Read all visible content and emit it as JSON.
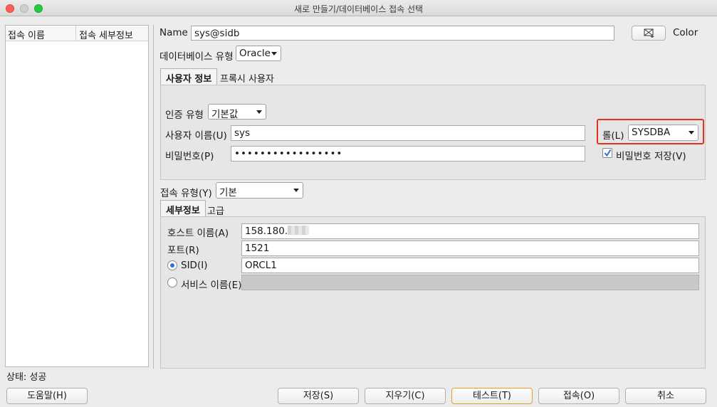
{
  "window": {
    "title": "새로 만들기/데이터베이스 접속 선택"
  },
  "connection_list": {
    "headers": [
      "접속 이름",
      "접속 세부정보"
    ]
  },
  "name": {
    "label": "Name",
    "value": "sys@sidb"
  },
  "color_button": {
    "label": "Color"
  },
  "db_type": {
    "label": "데이터베이스 유형",
    "value": "Oracle"
  },
  "tabs_top": [
    {
      "label": "사용자 정보",
      "active": true
    },
    {
      "label": "프록시 사용자",
      "active": false
    }
  ],
  "auth": {
    "label": "인증 유형",
    "value": "기본값"
  },
  "username": {
    "label": "사용자 이름(U)",
    "value": "sys"
  },
  "password": {
    "label": "비밀번호(P)",
    "value": "•••••••••••••••••"
  },
  "role": {
    "label": "롤(L)",
    "value": "SYSDBA"
  },
  "save_password": {
    "label": "비밀번호 저장(V)",
    "checked": true
  },
  "conn_type": {
    "label": "접속 유형(Y)",
    "value": "기본"
  },
  "tabs_bottom": [
    {
      "label": "세부정보",
      "active": true
    },
    {
      "label": "고급",
      "active": false
    }
  ],
  "host": {
    "label": "호스트 이름(A)",
    "value": "158.180."
  },
  "port": {
    "label": "포트(R)",
    "value": "1521"
  },
  "sid": {
    "label": "SID(I)",
    "value": "ORCL1",
    "selected": true
  },
  "service": {
    "label": "서비스 이름(E)",
    "value": "",
    "selected": false
  },
  "status": {
    "text": "상태: 성공"
  },
  "buttons": {
    "help": "도움말(H)",
    "save": "저장(S)",
    "clear": "지우기(C)",
    "test": "테스트(T)",
    "connect": "접속(O)",
    "cancel": "취소"
  },
  "colors": {
    "highlight": "#e0321c",
    "default_button_border": "#e6a020",
    "radio_selected": "#2f6fd8"
  }
}
